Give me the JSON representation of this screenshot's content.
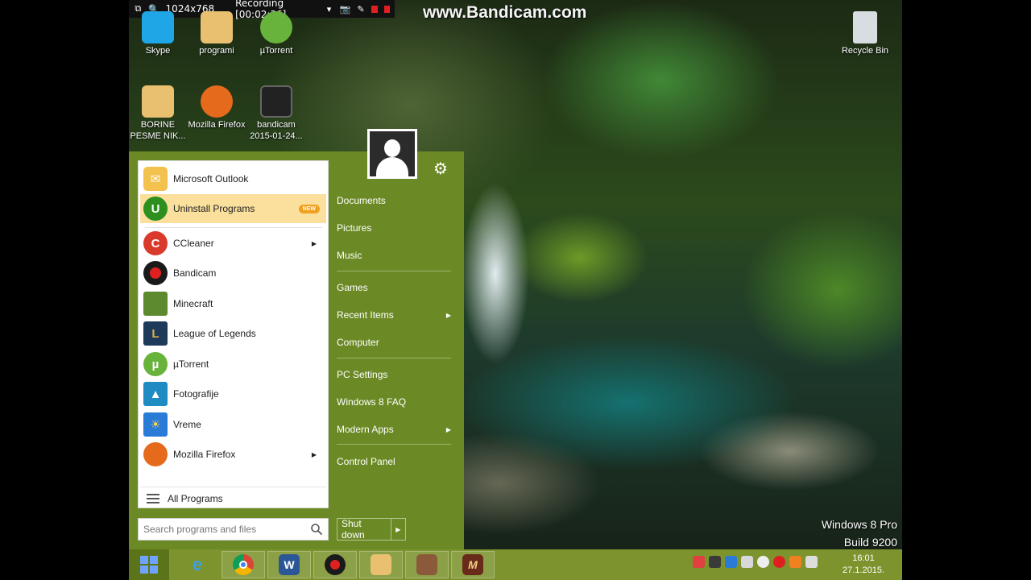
{
  "recording_bar": {
    "resolution": "1024x768",
    "status": "Recording [00:02:36]"
  },
  "watermark": "www.Bandicam.com",
  "desktop_icons": [
    {
      "label": "Skype"
    },
    {
      "label": "programi"
    },
    {
      "label": "µTorrent"
    },
    {
      "label": "Recycle Bin"
    },
    {
      "label": "BORINE PESME NIK..."
    },
    {
      "label": "Mozilla Firefox"
    },
    {
      "label": "bandicam 2015-01-24..."
    }
  ],
  "start_menu": {
    "programs": [
      {
        "label": "Microsoft Outlook",
        "icon": "outlook-icon",
        "color": "#f2c14e"
      },
      {
        "label": "Uninstall Programs",
        "icon": "uninstall-icon",
        "color": "#2d8f1e",
        "badge": "NEW",
        "highlighted": true
      },
      {
        "label": "CCleaner",
        "icon": "ccleaner-icon",
        "color": "#d93a2b",
        "submenu": true
      },
      {
        "label": "Bandicam",
        "icon": "bandicam-icon",
        "color": "#1a1a1a"
      },
      {
        "label": "Minecraft",
        "icon": "minecraft-icon",
        "color": "#5d8a2e"
      },
      {
        "label": "League of Legends",
        "icon": "league-of-legends-icon",
        "color": "#1e3a5a"
      },
      {
        "label": "µTorrent",
        "icon": "utorrent-icon",
        "color": "#68b33c"
      },
      {
        "label": "Fotografije",
        "icon": "photos-icon",
        "color": "#1e8bc3"
      },
      {
        "label": "Vreme",
        "icon": "weather-icon",
        "color": "#2a7bd8"
      },
      {
        "label": "Mozilla Firefox",
        "icon": "firefox-icon",
        "color": "#e66a1c",
        "submenu": true
      }
    ],
    "all_programs": "All Programs",
    "search_placeholder": "Search programs and files",
    "places": [
      {
        "label": "Documents"
      },
      {
        "label": "Pictures"
      },
      {
        "label": "Music"
      },
      {
        "label": "Games"
      },
      {
        "label": "Recent Items",
        "submenu": true
      },
      {
        "label": "Computer"
      },
      {
        "label": "PC Settings"
      },
      {
        "label": "Windows 8 FAQ"
      },
      {
        "label": "Modern Apps",
        "submenu": true
      },
      {
        "label": "Control Panel"
      }
    ],
    "shutdown_label": "Shut down"
  },
  "edition": {
    "line1": "Windows 8 Pro",
    "line2": "Build 9200"
  },
  "taskbar": {
    "pinned": [
      "internet-explorer-icon",
      "chrome-icon",
      "word-icon",
      "bandicam-icon",
      "file-explorer-icon",
      "game-character-icon",
      "metin2-icon"
    ],
    "clock_time": "16:01",
    "clock_date": "27.1.2015."
  },
  "colors": {
    "start_menu_green": "#6b8a25",
    "taskbar_green": "#7d942e",
    "highlight": "#fbdf9c"
  }
}
